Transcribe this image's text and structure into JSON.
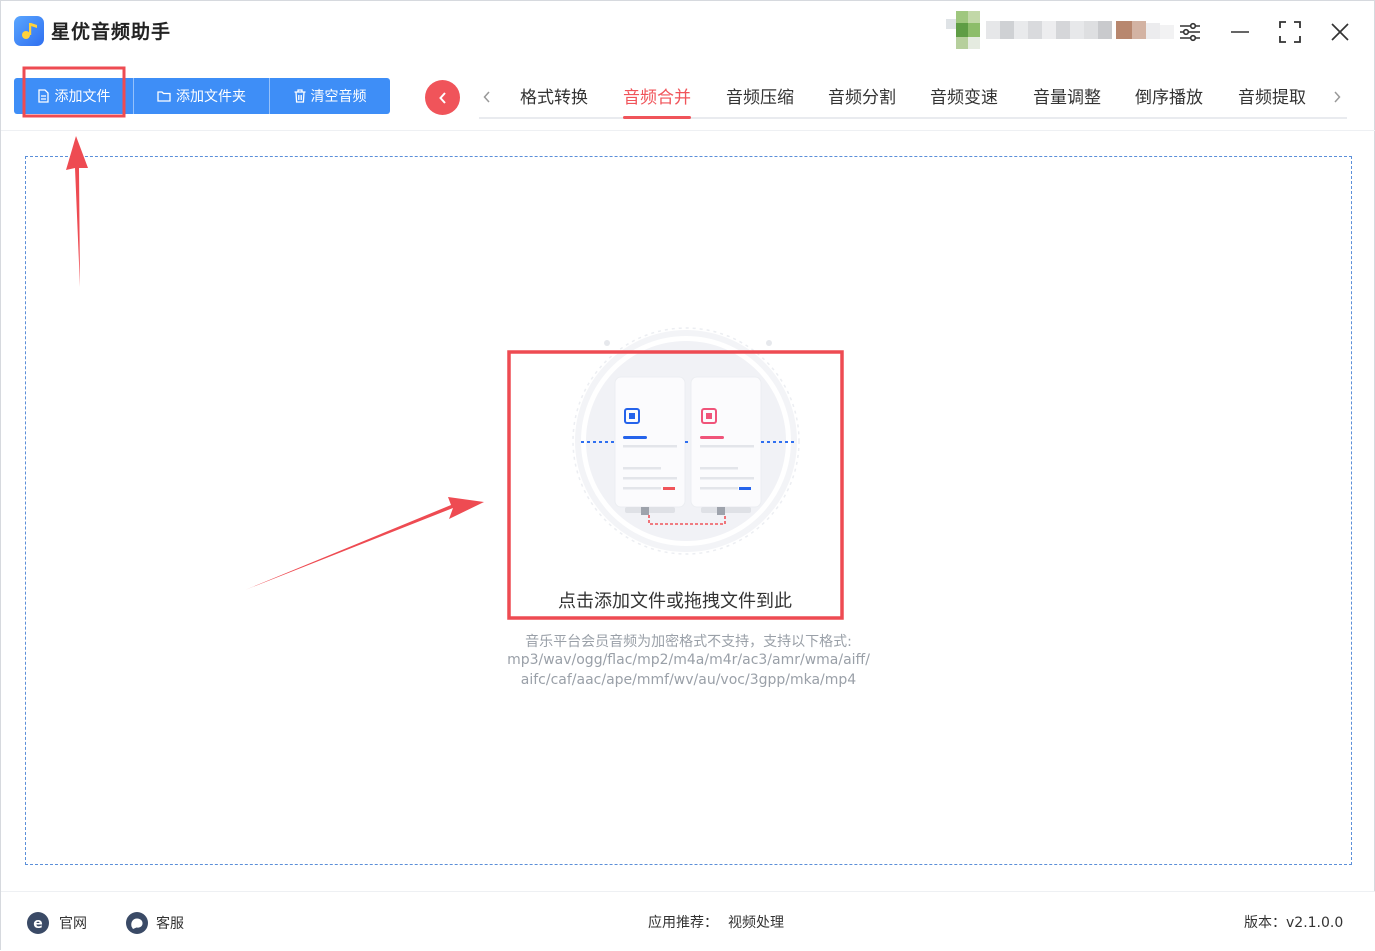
{
  "app": {
    "title": "星优音频助手"
  },
  "toolbar": {
    "add_file_label": "添加文件",
    "add_folder_label": "添加文件夹",
    "clear_label": "清空音频"
  },
  "tabs": [
    {
      "label": "格式转换",
      "active": false
    },
    {
      "label": "音频合并",
      "active": true
    },
    {
      "label": "音频压缩",
      "active": false
    },
    {
      "label": "音频分割",
      "active": false
    },
    {
      "label": "音频变速",
      "active": false
    },
    {
      "label": "音量调整",
      "active": false
    },
    {
      "label": "倒序播放",
      "active": false
    },
    {
      "label": "音频提取",
      "active": false
    }
  ],
  "dropzone": {
    "title": "点击添加文件或拖拽文件到此",
    "note_line1": "音乐平台会员音频为加密格式不支持，支持以下格式:",
    "note_line2": "mp3/wav/ogg/flac/mp2/m4a/m4r/ac3/amr/wma/aiff/",
    "note_line3": "aifc/caf/aac/ape/mmf/wv/au/voc/3gpp/mka/mp4"
  },
  "footer": {
    "website_label": "官网",
    "service_label": "客服",
    "recommend_label": "应用推荐：",
    "recommend_value": "视频处理",
    "version_label": "版本：v2.1.0.0"
  },
  "colors": {
    "accent_blue": "#3e8ef7",
    "accent_red": "#f0545a",
    "annotation_red": "#ee4b52"
  }
}
